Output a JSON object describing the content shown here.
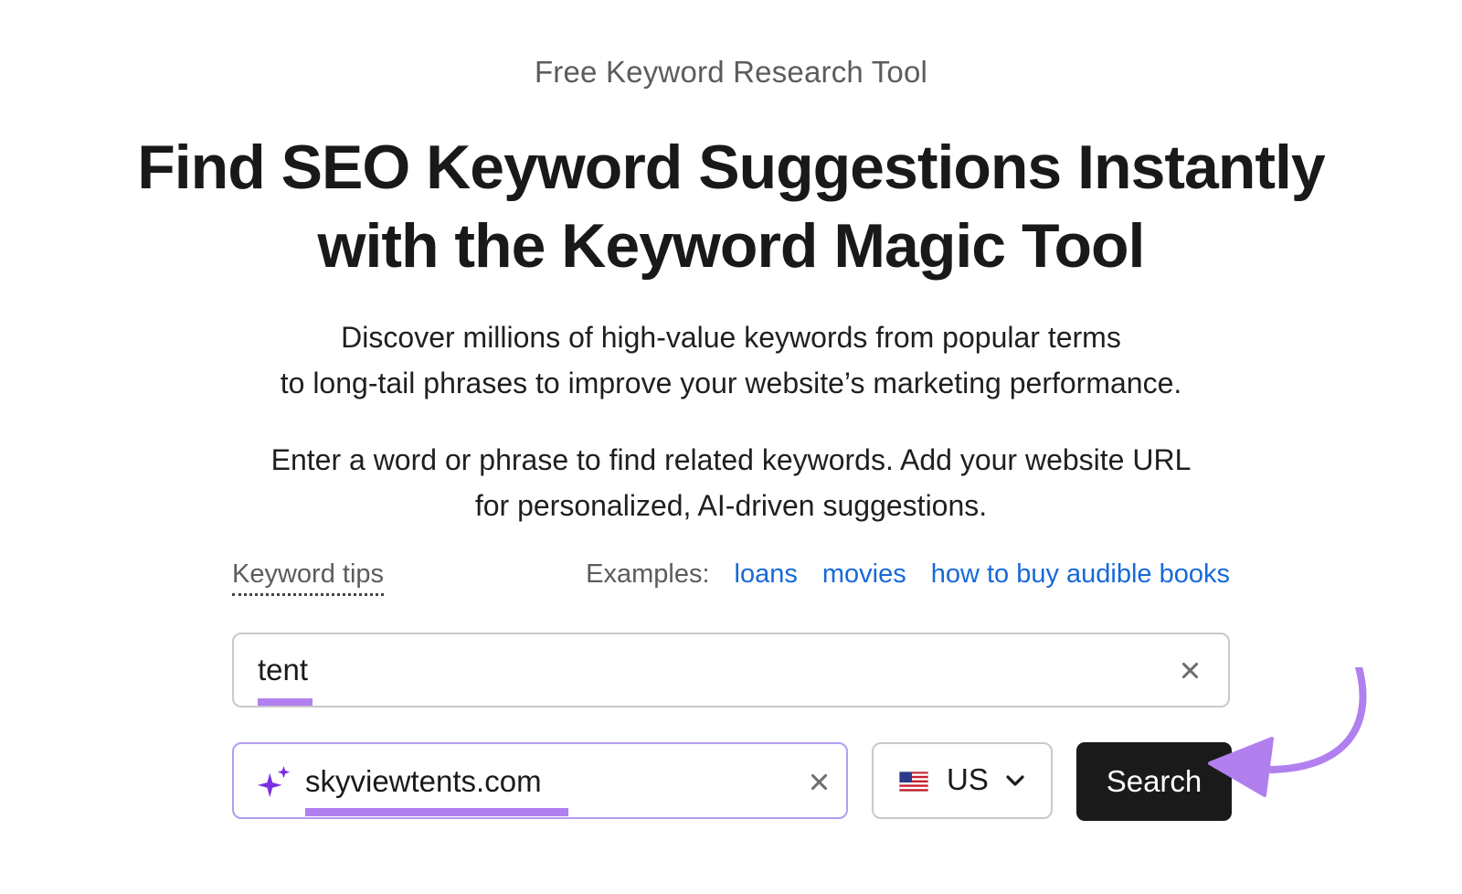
{
  "header": {
    "eyebrow": "Free Keyword Research Tool",
    "headline_line1": "Find SEO Keyword Suggestions Instantly",
    "headline_line2": "with the Keyword Magic Tool"
  },
  "description": {
    "line1": "Discover millions of high-value keywords from popular terms",
    "line2": "to long-tail phrases to improve your website’s marketing performance."
  },
  "instructions": {
    "line1": "Enter a word or phrase to find related keywords. Add your website URL",
    "line2": "for personalized, AI-driven suggestions."
  },
  "tips": {
    "keyword_tips_label": "Keyword tips",
    "examples_label": "Examples:",
    "examples": [
      "loans",
      "movies",
      "how to buy audible books"
    ]
  },
  "form": {
    "keyword_value": "tent",
    "url_value": "skyviewtents.com",
    "country": "US",
    "search_label": "Search"
  },
  "colors": {
    "highlight": "#b27fef",
    "link": "#1769d8",
    "button_bg": "#1a1a1a",
    "sparkle": "#7a2fe0",
    "arrow": "#b27fef"
  },
  "icons": {
    "clear": "close-icon",
    "ai": "sparkle-icon",
    "flag": "us-flag-icon",
    "dropdown": "chevron-down-icon",
    "annotation": "curved-arrow-icon"
  }
}
